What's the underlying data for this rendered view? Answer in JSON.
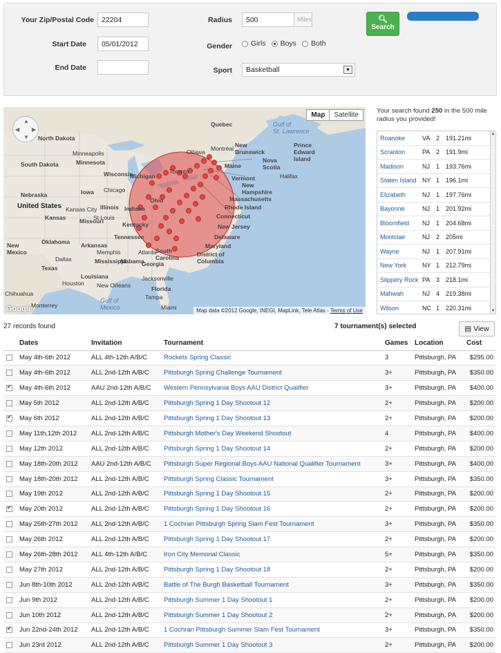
{
  "form": {
    "zip_label": "Your Zip/Postal Code",
    "zip_value": "22204",
    "start_label": "Start Date",
    "start_value": "05/01/2012",
    "end_label": "End Date",
    "end_value": "",
    "radius_label": "Radius",
    "radius_value": "500",
    "radius_unit": "Miles",
    "gender_label": "Gender",
    "gender_options": [
      "Girls",
      "Boys",
      "Both"
    ],
    "gender_selected": "Boys",
    "sport_label": "Sport",
    "sport_value": "Basketball",
    "search_label": "Search"
  },
  "map": {
    "tab_map": "Map",
    "tab_satellite": "Satellite",
    "credit": "Map data ©2012 Google, INEGI, MapLink, Tele Atlas -",
    "credit_link": "Terms of Use",
    "logo": "Google",
    "labels": {
      "north_dakota": "North\nDakota",
      "south_dakota": "South Dakota",
      "minnesota": "Minnesota",
      "wisconsin": "Wisconsin",
      "michigan": "Michigan",
      "iowa": "Iowa",
      "illinois": "Illinois",
      "indiana": "Indiana",
      "ohio": "Ohio",
      "nebraska": "Nebraska",
      "united_states": "United States",
      "kansas": "Kansas",
      "missouri": "Missouri",
      "kentucky": "Kentucky",
      "oklahoma": "Oklahoma",
      "tennessee": "Tennessee",
      "arkansas": "Arkansas",
      "new_mexico": "New\nMexico",
      "texas": "Texas",
      "mississippi": "Mississippi",
      "alabama": "Alabama",
      "georgia": "Georgia",
      "louisiana": "Louisiana",
      "florida": "Florida",
      "gulf_mexico": "Gulf of\nMexico",
      "chihuahua": "Chihuahua",
      "monterrey": "Monterrey",
      "houston": "Houston",
      "dallas": "Dallas",
      "new_orleans": "New Orleans",
      "jacksonville": "Jacksonville",
      "tampa": "Tampa",
      "miami": "Miami",
      "atlanta": "Atlanta",
      "memphis": "Memphis",
      "chicago": "Chicago",
      "minneapolis": "Minneapolis",
      "kansas_city": "Kansas City",
      "st_louis": "St Louis",
      "quebec": "Quebec",
      "new_brunswick": "New\nBrunswick",
      "prince_edward": "Prince\nEdward\nIsland",
      "nova_scotia": "Nova\nScotia",
      "gulf_st_lawrence": "Gulf of\nSt. Lawrence",
      "maine": "Maine",
      "vermont": "Vermont",
      "new_hampshire": "New\nHampshire",
      "massachusetts": "Massachusetts",
      "rhode_island": "Rhode Island",
      "connecticut": "Connecticut",
      "new_jersey": "New Jersey",
      "delaware": "Delaware",
      "maryland": "Maryland",
      "dc": "District of\nColumbia",
      "south_carolina": "South\nCarolina",
      "ottawa": "Ottawa",
      "toronto": "Toronto",
      "halifax": "Halifax",
      "montreal": "Montréal"
    }
  },
  "results": {
    "summary_pre": "Your search found ",
    "summary_count": "250",
    "summary_post": " in the 500 mile radius you provided!",
    "rows": [
      {
        "city": "Roanoke",
        "state": "VA",
        "count": "2",
        "distance": "191.21mi"
      },
      {
        "city": "Scranton",
        "state": "PA",
        "count": "2",
        "distance": "191.9mi"
      },
      {
        "city": "Madison",
        "state": "NJ",
        "count": "1",
        "distance": "193.76mi"
      },
      {
        "city": "Staten Island",
        "state": "NY",
        "count": "1",
        "distance": "196.1mi"
      },
      {
        "city": "Elizabeth",
        "state": "NJ",
        "count": "1",
        "distance": "197.76mi"
      },
      {
        "city": "Bayonne",
        "state": "NJ",
        "count": "1",
        "distance": "201.92mi"
      },
      {
        "city": "Bloomfield",
        "state": "NJ",
        "count": "1",
        "distance": "204.68mi"
      },
      {
        "city": "Montclair",
        "state": "NJ",
        "count": "2",
        "distance": "205mi"
      },
      {
        "city": "Wayne",
        "state": "NJ",
        "count": "1",
        "distance": "207.91mi"
      },
      {
        "city": "New York",
        "state": "NY",
        "count": "1",
        "distance": "212.79mi"
      },
      {
        "city": "Slippery Rock",
        "state": "PA",
        "count": "3",
        "distance": "218.1mi"
      },
      {
        "city": "Mahwah",
        "state": "NJ",
        "count": "4",
        "distance": "219.38mi"
      },
      {
        "city": "Wilson",
        "state": "NC",
        "count": "1",
        "distance": "220.31mi"
      }
    ]
  },
  "table": {
    "records_text": "27 records found",
    "selected_text": "7 tournament(s) selected",
    "view_label": "View",
    "headers": {
      "dates": "Dates",
      "invitation": "Invitation",
      "tournament": "Tournament",
      "games": "Games",
      "location": "Location",
      "cost": "Cost"
    },
    "rows": [
      {
        "checked": false,
        "dates": "May 4th-6th 2012",
        "invitation": "ALL 4th-12th A/B/C",
        "tournament": "Rockets Spring Classic",
        "games": "3",
        "location": "Pittsburgh, PA",
        "cost": "$295.00"
      },
      {
        "checked": false,
        "dates": "May 4th-6th 2012",
        "invitation": "ALL 2nd-12th A/B/C",
        "tournament": "Pittsburgh Spring Challenge Tournament",
        "games": "3+",
        "location": "Pittsburgh, PA",
        "cost": "$350.00"
      },
      {
        "checked": true,
        "dates": "May 4th-6th 2012",
        "invitation": "AAU 2nd-12th A/B/C",
        "tournament": "Western Pennsylvania Boys AAU District Qualifier",
        "games": "3+",
        "location": "Pittsburgh, PA",
        "cost": "$400.00"
      },
      {
        "checked": false,
        "dates": "May 5th 2012",
        "invitation": "ALL 2nd-12th A/B/C",
        "tournament": "Pittsburgh Spring 1 Day Shootout 12",
        "games": "2+",
        "location": "Pittsburgh, PA",
        "cost": "$200.00"
      },
      {
        "checked": true,
        "dates": "May 6th 2012",
        "invitation": "ALL 2nd-12th A/B/C",
        "tournament": "Pittsburgh Spring 1 Day Shootout 13",
        "games": "2+",
        "location": "Pittsburgh, PA",
        "cost": "$200.00"
      },
      {
        "checked": false,
        "dates": "May 11th,12th 2012",
        "invitation": "ALL 2nd-12th A/B/C",
        "tournament": "Pittsburgh Mother's Day Weekend Shootout",
        "games": "4",
        "location": "Pittsburgh, PA",
        "cost": "$400.00"
      },
      {
        "checked": false,
        "dates": "May 12th 2012",
        "invitation": "ALL 2nd-12th A/B/C",
        "tournament": "Pittsburgh Spring 1 Day Shootout 14",
        "games": "2+",
        "location": "Pittsburgh, PA",
        "cost": "$200.00"
      },
      {
        "checked": false,
        "dates": "May 18th-20th 2012",
        "invitation": "AAU 2nd-12th A/B/C",
        "tournament": "Pittsburgh Super Regional Boys AAU National Qualifier Tournament",
        "games": "3+",
        "location": "Pittsburgh, PA",
        "cost": "$400.00"
      },
      {
        "checked": false,
        "dates": "May 18th-20th 2012",
        "invitation": "ALL 2nd-12th A/B/C",
        "tournament": "Pittsburgh Spring Classic Tournament",
        "games": "3+",
        "location": "Pittsburgh, PA",
        "cost": "$350.00"
      },
      {
        "checked": false,
        "dates": "May 19th 2012",
        "invitation": "ALL 2nd-12th A/B/C",
        "tournament": "Pittsburgh Spring 1 Day Shootout 15",
        "games": "2+",
        "location": "Pittsburgh, PA",
        "cost": "$200.00"
      },
      {
        "checked": true,
        "dates": "May 20th 2012",
        "invitation": "ALL 2nd-12th A/B/C",
        "tournament": "Pittsburgh Spring 1 Day Shootout 16",
        "games": "2+",
        "location": "Pittsburgh, PA",
        "cost": "$200.00"
      },
      {
        "checked": false,
        "dates": "May 25th-27th 2012",
        "invitation": "ALL 2nd-12th A/B/C",
        "tournament": "1 Cochran Pittsburgh Spring Slam Fest Tournament",
        "games": "3+",
        "location": "Pittsburgh, PA",
        "cost": "$350.00"
      },
      {
        "checked": false,
        "dates": "May 26th 2012",
        "invitation": "ALL 2nd-12th A/B/C",
        "tournament": "Pittsburgh Spring 1 Day Shootout 17",
        "games": "2+",
        "location": "Pittsburgh, PA",
        "cost": "$200.00"
      },
      {
        "checked": false,
        "dates": "May 26th-28th 2012",
        "invitation": "ALL 4th-12th A/B/C",
        "tournament": "Iron City Memorial Classic",
        "games": "5+",
        "location": "Pittsburgh, PA",
        "cost": "$350.00"
      },
      {
        "checked": false,
        "dates": "May 27th 2012",
        "invitation": "ALL 2nd-12th A/B/C",
        "tournament": "Pittsburgh Spring 1 Day Shootout 18",
        "games": "2+",
        "location": "Pittsburgh, PA",
        "cost": "$200.00"
      },
      {
        "checked": false,
        "dates": "Jun 8th-10th 2012",
        "invitation": "ALL 2nd-12th A/B/C",
        "tournament": "Battle of The Burgh Basketball Tournament",
        "games": "3+",
        "location": "Pittsburgh, PA",
        "cost": "$350.00"
      },
      {
        "checked": false,
        "dates": "Jun 9th 2012",
        "invitation": "ALL 2nd-12th A/B/C",
        "tournament": "Pittsburgh Summer 1 Day Shootout 1",
        "games": "2+",
        "location": "Pittsburgh, PA",
        "cost": "$200.00"
      },
      {
        "checked": false,
        "dates": "Jun 10th 2012",
        "invitation": "ALL 2nd-12th A/B/C",
        "tournament": "Pittsburgh Summer 1 Day Shootout 2",
        "games": "2+",
        "location": "Pittsburgh, PA",
        "cost": "$200.00"
      },
      {
        "checked": true,
        "dates": "Jun 22nd-24th 2012",
        "invitation": "ALL 2nd-12th A/B/C",
        "tournament": "1 Cochran Pittsburgh Summer Slam Fest Tournament",
        "games": "3+",
        "location": "Pittsburgh, PA",
        "cost": "$350.00"
      },
      {
        "checked": false,
        "dates": "Jun 23rd 2012",
        "invitation": "ALL 2nd-12th A/B/C",
        "tournament": "Pittsburgh Summer 1 Day Shootout 3",
        "games": "2+",
        "location": "Pittsburgh, PA",
        "cost": "$200.00"
      }
    ]
  },
  "colors": {
    "accent_green": "#4caf50",
    "link_blue": "#1a5a9a",
    "radius_red": "#e04848"
  }
}
